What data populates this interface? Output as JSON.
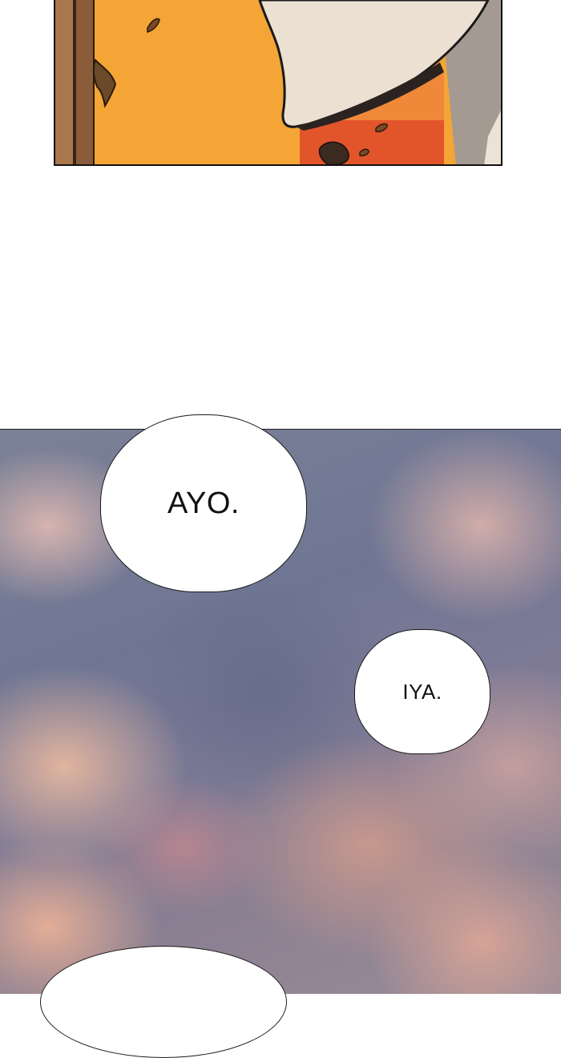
{
  "panels": {
    "top": {
      "description_colors": {
        "wall": "#f4a535",
        "accent": "#e2552b",
        "door": "#a9774e",
        "sleeve": "#ecdcc8"
      }
    },
    "sky": {
      "colors": {
        "base": "#6f7694",
        "cloud": "#e8b8a4"
      }
    }
  },
  "bubbles": {
    "ayo": {
      "text": "AYO."
    },
    "iya": {
      "text": "IYA."
    }
  }
}
